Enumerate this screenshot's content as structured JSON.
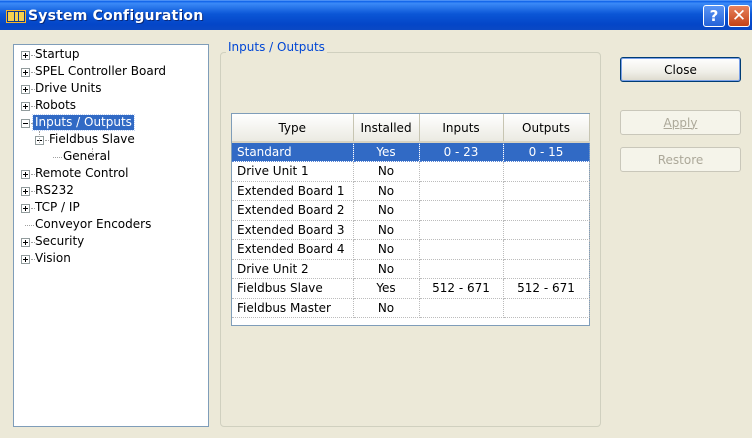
{
  "window": {
    "title": "System Configuration",
    "help_button": "?",
    "close_glyph": "✕"
  },
  "tree": {
    "items": [
      {
        "label": "Startup",
        "expander": "plus"
      },
      {
        "label": "SPEL Controller Board",
        "expander": "plus"
      },
      {
        "label": "Drive Units",
        "expander": "plus"
      },
      {
        "label": "Robots",
        "expander": "plus"
      },
      {
        "label": "Inputs / Outputs",
        "expander": "minus",
        "selected": true
      },
      {
        "label": "Fieldbus Slave",
        "expander": "minus"
      },
      {
        "label": "General",
        "expander": "none"
      },
      {
        "label": "Remote Control",
        "expander": "plus"
      },
      {
        "label": "RS232",
        "expander": "plus"
      },
      {
        "label": "TCP / IP",
        "expander": "plus"
      },
      {
        "label": "Conveyor Encoders",
        "expander": "none"
      },
      {
        "label": "Security",
        "expander": "plus"
      },
      {
        "label": "Vision",
        "expander": "plus"
      }
    ]
  },
  "panel": {
    "group_title": "Inputs / Outputs",
    "table": {
      "headers": [
        "Type",
        "Installed",
        "Inputs",
        "Outputs"
      ],
      "rows": [
        {
          "type": "Standard",
          "installed": "Yes",
          "inputs": "0 - 23",
          "outputs": "0 - 15",
          "selected": true
        },
        {
          "type": "Drive Unit 1",
          "installed": "No",
          "inputs": "",
          "outputs": ""
        },
        {
          "type": "Extended Board 1",
          "installed": "No",
          "inputs": "",
          "outputs": ""
        },
        {
          "type": "Extended Board 2",
          "installed": "No",
          "inputs": "",
          "outputs": ""
        },
        {
          "type": "Extended Board 3",
          "installed": "No",
          "inputs": "",
          "outputs": ""
        },
        {
          "type": "Extended Board 4",
          "installed": "No",
          "inputs": "",
          "outputs": ""
        },
        {
          "type": "Drive Unit 2",
          "installed": "No",
          "inputs": "",
          "outputs": ""
        },
        {
          "type": "Fieldbus Slave",
          "installed": "Yes",
          "inputs": "512 - 671",
          "outputs": "512 - 671"
        },
        {
          "type": "Fieldbus Master",
          "installed": "No",
          "inputs": "",
          "outputs": ""
        }
      ]
    }
  },
  "buttons": {
    "close": "Close",
    "apply": "Apply",
    "restore": "Restore"
  },
  "icons": {
    "app": "io-board-icon",
    "help": "question-icon",
    "close": "close-icon"
  },
  "colors": {
    "selection": "#316ac5",
    "group_title": "#0046d5",
    "titlebar": "#0a56d6"
  }
}
